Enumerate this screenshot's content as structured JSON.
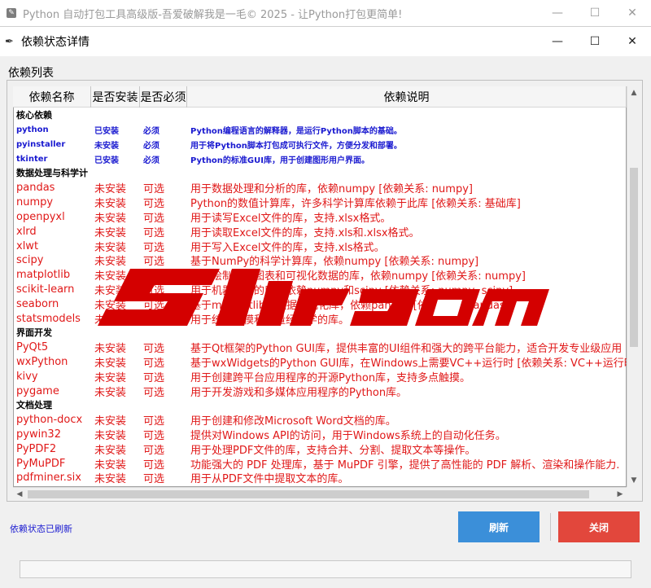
{
  "main_window": {
    "title": "Python 自动打包工具高级版-吾爱破解我是一毛© 2025 - 让Python打包更简单!",
    "app_icon": "python-feather-icon"
  },
  "dialog": {
    "title": "依赖状态详情",
    "group_title": "依赖列表",
    "columns": [
      "依赖名称",
      "是否安装",
      "是否必须",
      "依赖说明"
    ],
    "sections": [
      {
        "category": "核心依赖",
        "style": "core",
        "rows": [
          [
            "python",
            "已安装",
            "必须",
            "Python编程语言的解释器，是运行Python脚本的基础。"
          ],
          [
            "pyinstaller",
            "未安装",
            "必须",
            "用于将Python脚本打包成可执行文件，方便分发和部署。"
          ],
          [
            "tkinter",
            "已安装",
            "必须",
            "Python的标准GUI库，用于创建图形用户界面。"
          ]
        ]
      },
      {
        "category": "数据处理与科学计",
        "style": "opt",
        "rows": [
          [
            "pandas",
            "未安装",
            "可选",
            "用于数据处理和分析的库，依赖numpy [依赖关系: numpy]"
          ],
          [
            "numpy",
            "未安装",
            "可选",
            "Python的数值计算库，许多科学计算库依赖于此库 [依赖关系: 基础库]"
          ],
          [
            "openpyxl",
            "未安装",
            "可选",
            "用于读写Excel文件的库，支持.xlsx格式。"
          ],
          [
            "xlrd",
            "未安装",
            "可选",
            "用于读取Excel文件的库，支持.xls和.xlsx格式。"
          ],
          [
            "xlwt",
            "未安装",
            "可选",
            "用于写入Excel文件的库，支持.xls格式。"
          ],
          [
            "scipy",
            "未安装",
            "可选",
            "基于NumPy的科学计算库，依赖numpy [依赖关系: numpy]"
          ],
          [
            "matplotlib",
            "未安装",
            "可选",
            "用于绘制各种图表和可视化数据的库，依赖numpy [依赖关系: numpy]"
          ],
          [
            "scikit-learn",
            "未安装",
            "可选",
            "用于机器学习的库，依赖numpy和scipy [依赖关系: numpy, scipy]"
          ],
          [
            "seaborn",
            "未安装",
            "可选",
            "基于matplotlib的数据可视化库，依赖pandas [依赖关系: pandas]"
          ],
          [
            "statsmodels",
            "未安装",
            "可选",
            "用于统计建模和计量经济学的库。"
          ]
        ]
      },
      {
        "category": "界面开发",
        "style": "opt",
        "rows": [
          [
            "PyQt5",
            "未安装",
            "可选",
            "基于Qt框架的Python GUI库，提供丰富的UI组件和强大的跨平台能力，适合开发专业级应用"
          ],
          [
            "wxPython",
            "未安装",
            "可选",
            "基于wxWidgets的Python GUI库，在Windows上需要VC++运行时 [依赖关系: VC++运行时]"
          ],
          [
            "kivy",
            "未安装",
            "可选",
            "用于创建跨平台应用程序的开源Python库，支持多点触摸。"
          ],
          [
            "pygame",
            "未安装",
            "可选",
            "用于开发游戏和多媒体应用程序的Python库。"
          ]
        ]
      },
      {
        "category": "文档处理",
        "style": "opt",
        "rows": [
          [
            "python-docx",
            "未安装",
            "可选",
            "用于创建和修改Microsoft Word文档的库。"
          ],
          [
            "pywin32",
            "未安装",
            "可选",
            "提供对Windows API的访问，用于Windows系统上的自动化任务。"
          ],
          [
            "PyPDF2",
            "未安装",
            "可选",
            "用于处理PDF文件的库，支持合并、分割、提取文本等操作。"
          ],
          [
            "PyMuPDF",
            "未安装",
            "可选",
            "功能强大的 PDF 处理库，基于 MuPDF 引擎，提供了高性能的 PDF 解析、渲染和操作能力."
          ],
          [
            "pdfminer.six",
            "未安装",
            "可选",
            "用于从PDF文件中提取文本的库。"
          ]
        ]
      }
    ],
    "status_text": "依赖状态已刷新",
    "refresh_label": "刷新",
    "close_label": "关闭"
  },
  "colors": {
    "core_text": "#1a1ad0",
    "optional_text": "#e01818",
    "refresh_button": "#3b8fd9",
    "close_button": "#e2473c"
  },
  "watermark": {
    "text": "Sdbeta.com"
  }
}
